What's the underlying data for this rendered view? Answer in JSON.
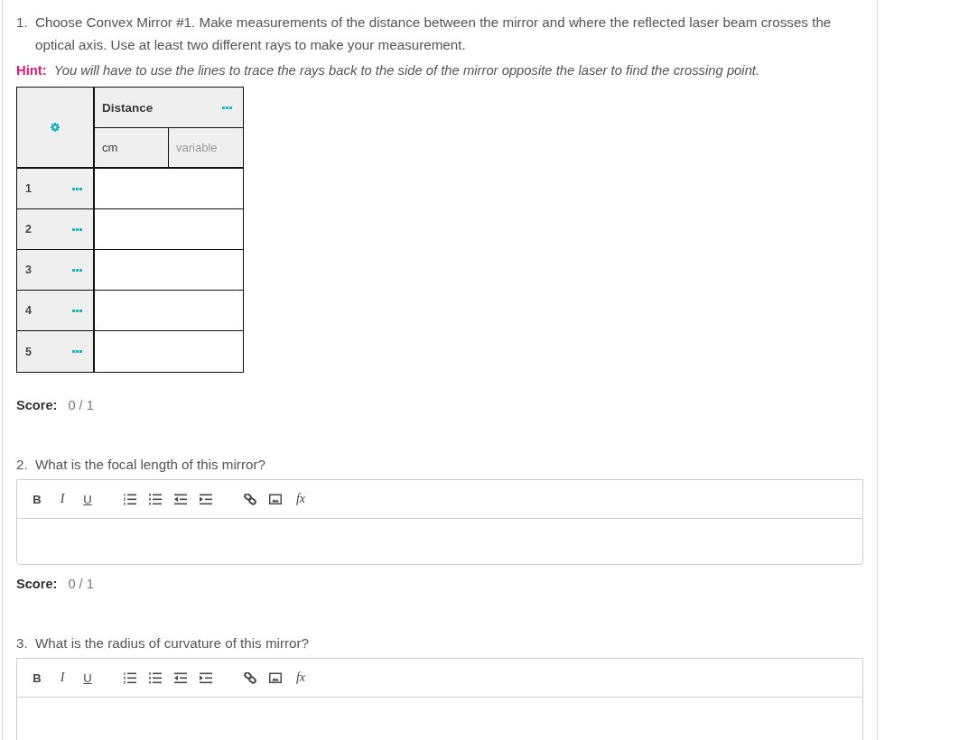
{
  "questions": [
    {
      "kind": "table",
      "number": "1.",
      "text": "Choose Convex Mirror #1. Make measurements of the distance between the mirror and where the reflected laser beam crosses the optical axis. Use at least two different rays to make your measurement.",
      "hint": {
        "label": "Hint:",
        "text": "You will have to use the lines to trace the rays back to the side of the mirror opposite the laser to find the crossing point."
      },
      "table": {
        "columns": [
          {
            "title": "Distance",
            "unit": "cm",
            "variable": "variable"
          }
        ],
        "rows": [
          {
            "label": "1"
          },
          {
            "label": "2"
          },
          {
            "label": "3"
          },
          {
            "label": "4"
          },
          {
            "label": "5"
          }
        ]
      },
      "score": {
        "label": "Score:",
        "value": "0 / 1"
      }
    },
    {
      "kind": "editor",
      "number": "2.",
      "text": "What is the focal length of this mirror?",
      "toolbar": {
        "format_buttons": [
          "B",
          "I",
          "U"
        ],
        "formula_button": "fx"
      },
      "score": {
        "label": "Score:",
        "value": "0 / 1"
      }
    },
    {
      "kind": "editor",
      "number": "3.",
      "text": "What is the radius of curvature of this mirror?",
      "toolbar": {
        "format_buttons": [
          "B",
          "I",
          "U"
        ],
        "formula_button": "fx"
      }
    }
  ]
}
